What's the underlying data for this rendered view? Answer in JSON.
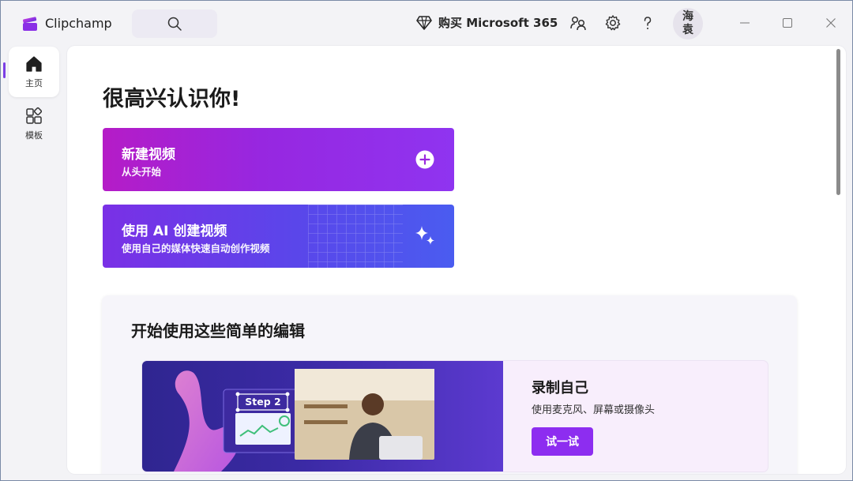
{
  "app": {
    "name": "Clipchamp"
  },
  "header": {
    "buy_label": "购买 Microsoft 365",
    "avatar_line1": "海",
    "avatar_line2": "袁"
  },
  "rail": {
    "items": [
      {
        "label": "主页",
        "icon": "home-icon",
        "active": true
      },
      {
        "label": "模板",
        "icon": "templates-icon",
        "active": false
      }
    ]
  },
  "main": {
    "greeting": "很高兴认识你!",
    "cards": [
      {
        "title": "新建视频",
        "subtitle": "从头开始",
        "icon": "plus-circle-icon"
      },
      {
        "title": "使用 AI 创建视频",
        "subtitle": "使用自己的媒体快速自动创作视频",
        "icon": "sparkle-icon"
      }
    ],
    "section": {
      "title": "开始使用这些简单的编辑",
      "feature": {
        "title": "录制自己",
        "description": "使用麦克风、屏幕或摄像头",
        "button_label": "试一试",
        "art_step_label": "Step 2"
      }
    }
  },
  "colors": {
    "accent": "#8d2df0",
    "new_video_gradient_start": "#b51cc7",
    "ai_card_gradient_end": "#4a5cf0"
  }
}
